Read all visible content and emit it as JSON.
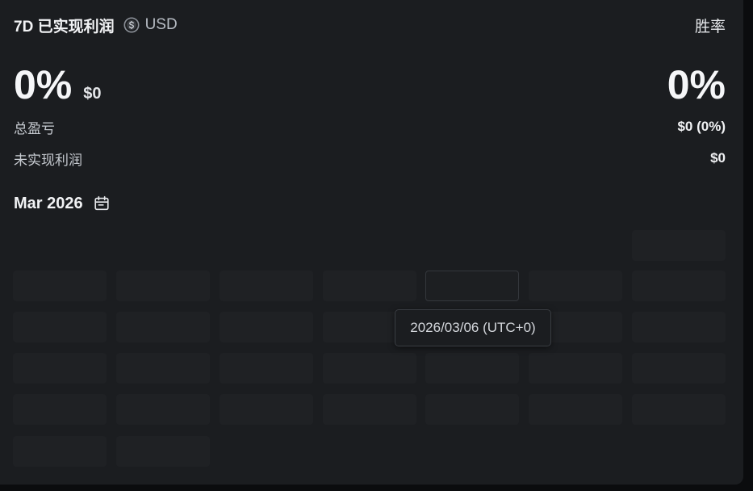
{
  "header": {
    "title": "7D 已实现利润",
    "currency": "USD",
    "currency_icon": "coin-swap-icon",
    "winrate_label": "胜率"
  },
  "summary": {
    "pnl_percent": "0%",
    "pnl_amount": "$0",
    "winrate_value": "0%"
  },
  "stats": [
    {
      "label": "总盈亏",
      "value": "$0 (0%)"
    },
    {
      "label": "未实现利润",
      "value": "$0"
    }
  ],
  "calendar": {
    "month": "Mar 2026",
    "icon": "calendar-icon",
    "tooltip": "2026/03/06 (UTC+0)",
    "hover_day": "2026/03/06"
  },
  "colors": {
    "card_bg": "#1b1d20",
    "page_bg": "#0b0c0e",
    "cell_bg": "#1f2124",
    "text_primary": "#f2f3f5",
    "text_secondary": "#c6cad0"
  }
}
